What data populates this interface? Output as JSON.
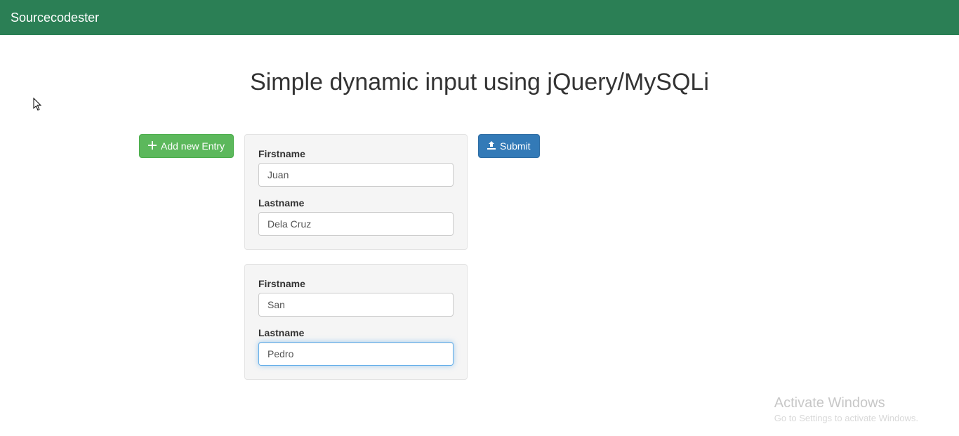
{
  "navbar": {
    "brand": "Sourcecodester"
  },
  "page": {
    "title": "Simple dynamic input using jQuery/MySQLi"
  },
  "buttons": {
    "add": "Add new Entry",
    "submit": "Submit"
  },
  "labels": {
    "firstname": "Firstname",
    "lastname": "Lastname"
  },
  "entries": [
    {
      "firstname": "Juan",
      "lastname": "Dela Cruz"
    },
    {
      "firstname": "San",
      "lastname": "Pedro"
    }
  ],
  "watermark": {
    "title": "Activate Windows",
    "sub": "Go to Settings to activate Windows."
  }
}
